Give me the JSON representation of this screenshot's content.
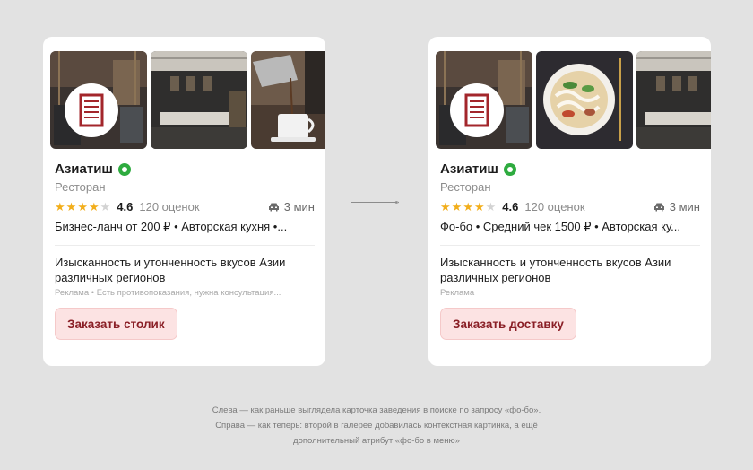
{
  "cards": [
    {
      "name": "Азиатиш",
      "category": "Ресторан",
      "rating": "4.6",
      "stars_filled": 4,
      "reviews": "120 оценок",
      "travel_time": "3 мин",
      "attributes": "Бизнес-ланч от 200 ₽ • Авторская кухня •...",
      "description": "Изысканность и утонченность вкусов Азии различных регионов",
      "ad_label": "Реклама • Есть противопоказания, нужна консультация...",
      "cta": "Заказать столик",
      "gallery": [
        "logo-interior-photo",
        "interior-photo",
        "coffee-photo"
      ]
    },
    {
      "name": "Азиатиш",
      "category": "Ресторан",
      "rating": "4.6",
      "stars_filled": 4,
      "reviews": "120 оценок",
      "travel_time": "3 мин",
      "attributes": "Фо-бо • Средний чек 1500 ₽ • Авторская ку...",
      "description": "Изысканность и утонченность вкусов Азии различных регионов",
      "ad_label": "Реклама",
      "cta": "Заказать доставку",
      "gallery": [
        "logo-interior-photo",
        "pho-bowl-photo",
        "interior-photo"
      ]
    }
  ],
  "caption": [
    "Слева — как раньше выглядела карточка заведения в поиске по запросу «фо-бо».",
    "Справа — как теперь: второй в галерее добавилась контекстная картинка, а ещё",
    "дополнительный атрибут «фо-бо в меню»"
  ],
  "colors": {
    "background": "#e2e2e2",
    "star": "#f2ae1b",
    "verified_badge": "#2eab3f",
    "cta_background": "#fce3e3",
    "cta_text": "#8a1f26"
  }
}
